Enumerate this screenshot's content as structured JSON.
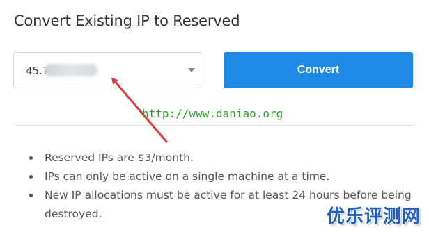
{
  "header": {
    "title": "Convert Existing IP to Reserved"
  },
  "ip_select": {
    "value": "45.7",
    "icon": "chevron-down-icon"
  },
  "convert_button": {
    "label": "Convert"
  },
  "notes": [
    "Reserved IPs are $3/month.",
    "IPs can only be active on a single machine at a time.",
    "New IP allocations must be active for at least 24 hours before being destroyed."
  ],
  "watermark": {
    "url": "http://www.daniao.org",
    "brand": "优乐评测网"
  },
  "colors": {
    "button": "#1e8ae6",
    "arrow": "#e03a3a",
    "url": "#2e9e2e",
    "brand": "#1f5fbf"
  }
}
